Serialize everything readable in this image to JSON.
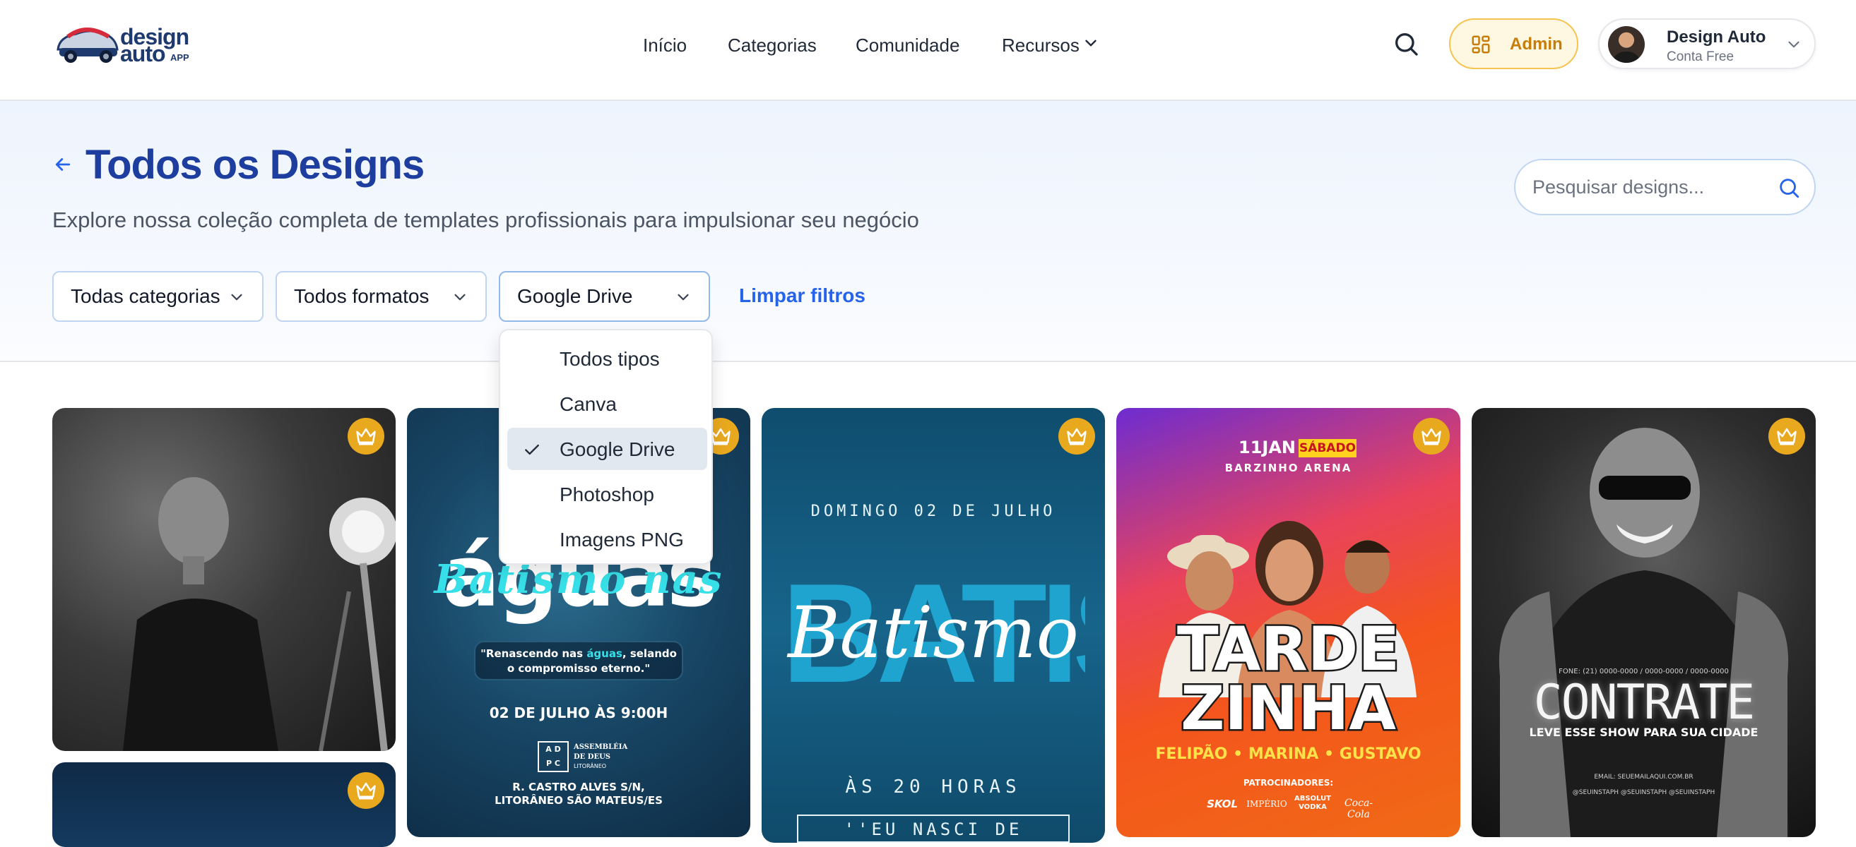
{
  "brand": {
    "line1": "design",
    "line2": "auto",
    "suffix": "APP"
  },
  "nav": {
    "items": [
      "Início",
      "Categorias",
      "Comunidade",
      "Recursos"
    ]
  },
  "header": {
    "admin_label": "Admin",
    "user_name": "Design Auto",
    "user_plan": "Conta Free"
  },
  "page": {
    "title": "Todos os Designs",
    "subtitle": "Explore nossa coleção completa de templates profissionais para impulsionar seu negócio"
  },
  "search": {
    "placeholder": "Pesquisar designs..."
  },
  "filters": {
    "category": "Todas categorias",
    "format": "Todos formatos",
    "type": "Google Drive",
    "clear_label": "Limpar filtros"
  },
  "type_dropdown": {
    "options": [
      "Todos tipos",
      "Canva",
      "Google Drive",
      "Photoshop",
      "Imagens PNG"
    ],
    "selected": "Google Drive"
  },
  "cards": {
    "c2": {
      "word": "águas",
      "script": "Batismo nas",
      "quote_a": "\"Renascendo nas ",
      "quote_hl": "águas",
      "quote_b": ", selando",
      "quote_c": "o compromisso eterno.\"",
      "date": "02 DE JULHO ÀS 9:00H",
      "church": "ASSEMBLÉIA DE DEUS",
      "church_sub": "LITORÂNEO",
      "address_1": "R. CASTRO ALVES S/N,",
      "address_2": "LITORÂNEO SÃO MATEUS/ES"
    },
    "c3": {
      "date": "DOMINGO 02 DE JULHO",
      "bg_word": "BATISMO",
      "script": "Batismo",
      "time": "ÀS 20 HORAS",
      "quote": "''EU NASCI DE NOVO''"
    },
    "c4": {
      "date_a": "11JAN",
      "date_b": "SÁBADO",
      "venue": "BARZINHO ARENA",
      "title_1": "TARDE",
      "title_2": "ZINHA",
      "artists": "FELIPÃO • MARINA • GUSTAVO",
      "sponsors_label": "PATROCINADORES:",
      "sponsors": [
        "SKOL",
        "IMPÉRIO",
        "ABSOLUT VODKA",
        "Coca-Cola"
      ]
    },
    "c5": {
      "phones": "FONE: (21) 0000-0000 / 0000-0000 / 0000-0000",
      "title": "CONTRATE",
      "subtitle": "LEVE ESSE SHOW PARA SUA CIDADE",
      "email": "EMAIL: SEUEMAILAQUI.COM.BR",
      "social": "@SEUINSTAPH  @SEUINSTAPH  @SEUINSTAPH"
    }
  },
  "colors": {
    "title_blue": "#1d3e9e",
    "link_blue": "#2563eb",
    "admin_gold": "#c77d0a",
    "crown_gold": "#e9a91f"
  }
}
